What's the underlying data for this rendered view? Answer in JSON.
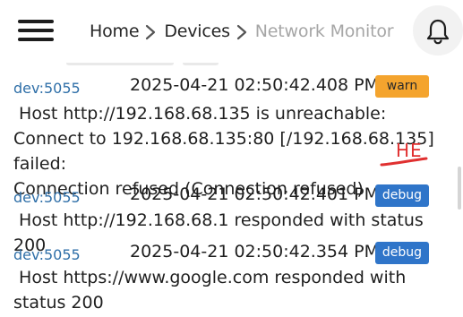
{
  "header": {
    "menu_icon": "hamburger-menu-icon",
    "breadcrumb": {
      "home": "Home",
      "devices": "Devices",
      "current": "Network Monitor"
    },
    "notification_icon": "bell-icon"
  },
  "logs": [
    {
      "source": "dev:5055",
      "timestamp": "2025-04-21 02:50:42.408 PM",
      "level": "warn",
      "message": " Host http://192.168.68.135 is unreachable: Connect to 192.168.68.135:80 [/192.168.68.135] failed:\nConnection refused (Connection refused)",
      "annotation": "HE"
    },
    {
      "source": "dev:5055",
      "timestamp": "2025-04-21 02:50:42.401 PM",
      "level": "debug",
      "message": " Host http://192.168.68.1 responded with status 200"
    },
    {
      "source": "dev:5055",
      "timestamp": "2025-04-21 02:50:42.354 PM",
      "level": "debug",
      "message": " Host https://www.google.com responded with status 200"
    }
  ],
  "colors": {
    "source_link": "#2f6fa8",
    "warn_badge": "#f4a42e",
    "debug_badge": "#2f75c9",
    "annotation": "#e03030",
    "breadcrumb_current": "#a6a6a6"
  }
}
